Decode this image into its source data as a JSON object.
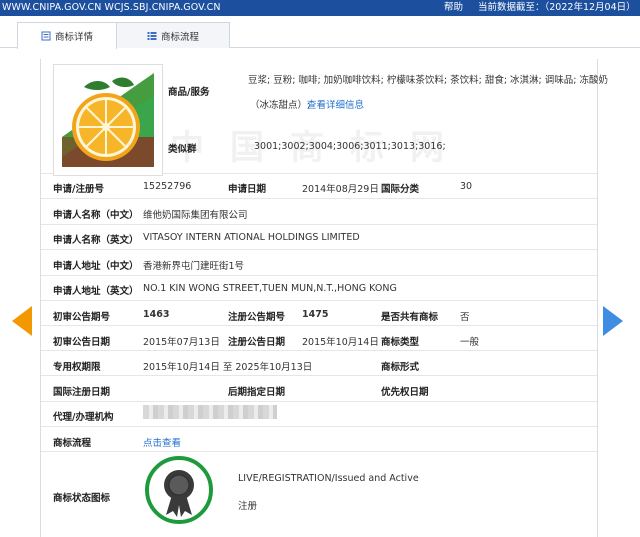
{
  "topbar": {
    "site": "WWW.CNIPA.GOV.CN WCJS.SBJ.CNIPA.GOV.CN",
    "help": "帮助",
    "date_label": "当前数据截至：",
    "date_value": "（2022年12月04日）",
    "bg_color": "#1c4f9e"
  },
  "tabs": [
    {
      "label": "商标详情",
      "icon": "document-icon",
      "active": true
    },
    {
      "label": "商标流程",
      "icon": "list-icon",
      "active": false
    }
  ],
  "detail": {
    "goods_label": "商品/服务",
    "goods_line1": "豆浆; 豆粉; 咖啡; 加奶咖啡饮料; 柠檬味茶饮料; 茶饮料; 甜食; 冰淇淋; 调味品; 冻酸奶",
    "goods_line2": "（冰冻甜点）;",
    "goods_more": "查看详细信息",
    "similar_label": "类似群",
    "similar_value": "3001;3002;3004;3006;3011;3013;3016;",
    "reg_no_label": "申请/注册号",
    "reg_no": "15252796",
    "apply_date_label": "申请日期",
    "apply_date": "2014年08月29日",
    "intl_class_label": "国际分类",
    "intl_class": "30",
    "applicant_cn_label": "申请人名称（中文）",
    "applicant_cn": "维他奶国际集团有限公司",
    "applicant_en_label": "申请人名称（英文）",
    "applicant_en": "VITASOY  INTERN ATIONAL HOLDINGS LIMITED",
    "address_cn_label": "申请人地址（中文）",
    "address_cn": "香港新界屯门建旺街1号",
    "address_en_label": "申请人地址（英文）",
    "address_en": "NO.1 KIN WONG STREET,TUEN MUN,N.T.,HONG KONG",
    "first_pub_no_label": "初审公告期号",
    "first_pub_no": "1463",
    "reg_pub_no_label": "注册公告期号",
    "reg_pub_no": "1475",
    "shared_label": "是否共有商标",
    "shared": "否",
    "first_pub_date_label": "初审公告日期",
    "first_pub_date": "2015年07月13日",
    "reg_pub_date_label": "注册公告日期",
    "reg_pub_date": "2015年10月14日",
    "type_label": "商标类型",
    "type": "一般",
    "right_period_label": "专用权期限",
    "right_period": "2015年10月14日 至 2025年10月13日",
    "form_label": "商标形式",
    "intl_reg_date_label": "国际注册日期",
    "later_date_label": "后期指定日期",
    "priority_date_label": "优先权日期",
    "agent_label": "代理/办理机构",
    "process_label": "商标流程",
    "process_link": "点击查看",
    "status_label": "商标状态图标",
    "status_en": "LIVE/REGISTRATION/Issued and Active",
    "status_cn": "注册",
    "seal_color": "#1e9a3c"
  },
  "watermark": "中国商标网"
}
